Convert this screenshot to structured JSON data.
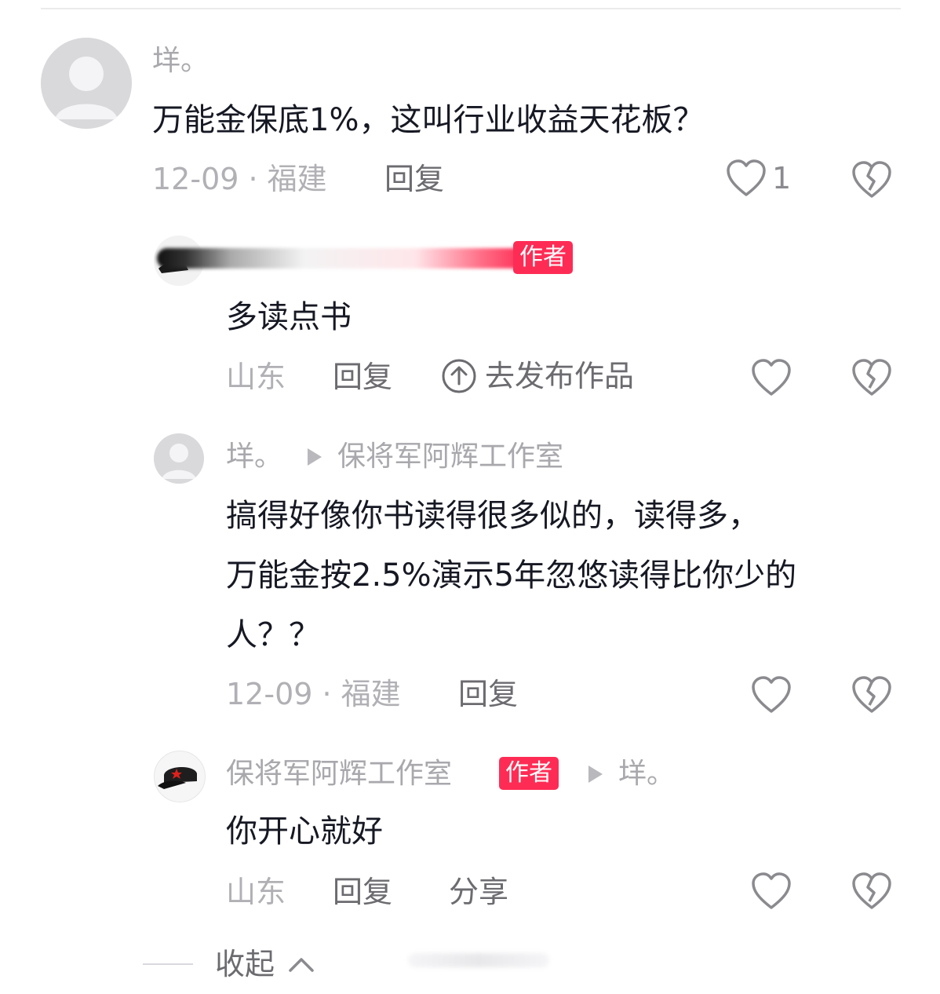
{
  "comments": [
    {
      "name": "垟。",
      "text": "万能金保底1%，这叫行业收益天花板？",
      "date_loc": "12-09 · 福建",
      "reply": "回复",
      "likes": "1"
    },
    {
      "badge": "作者",
      "text": "多读点书",
      "location": "山东",
      "reply": "回复",
      "action": "去发布作品"
    },
    {
      "name": "垟。",
      "reply_to": "保将军阿辉工作室",
      "text_lines": [
        "搞得好像你书读得很多似的，读得多，",
        "万能金按2.5%演示5年忽悠读得比你少的",
        "人？？"
      ],
      "date_loc": "12-09 · 福建",
      "reply": "回复"
    },
    {
      "name": "保将军阿辉工作室",
      "badge": "作者",
      "reply_to": "垟。",
      "text": "你开心就好",
      "location": "山东",
      "reply": "回复",
      "share": "分享"
    }
  ],
  "collapse_label": "收起",
  "colors": {
    "accent": "#fe2c55",
    "muted": "#b0b0b5",
    "text": "#161823"
  },
  "icons": [
    "default-avatar-icon",
    "cap-avatar-icon",
    "heart-icon",
    "broken-heart-icon",
    "upload-icon",
    "play-triangle-icon",
    "chevron-up-icon"
  ]
}
